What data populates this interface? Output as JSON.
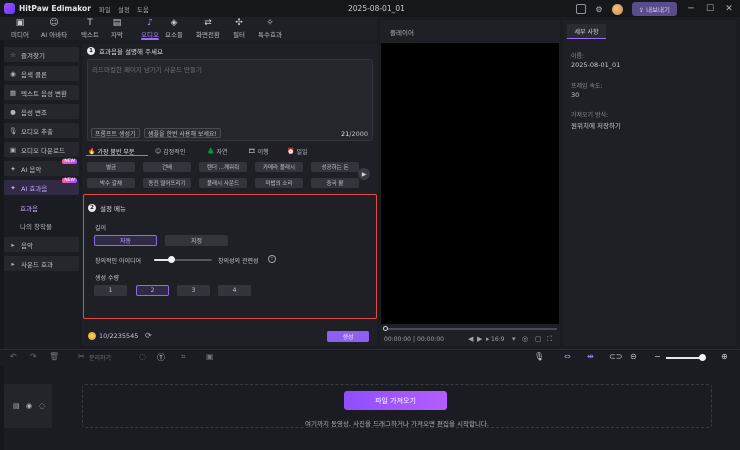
{
  "app": {
    "name": "HitPaw Edimakor",
    "menu": [
      "파일",
      "설정",
      "도움"
    ],
    "project_title": "2025-08-01_01",
    "export_label": "내보내기",
    "window_controls": {
      "minimize": "─",
      "maximize": "☐",
      "close": "✕"
    }
  },
  "toolbar": {
    "active": "오디오",
    "tools": [
      {
        "label": "미디어",
        "icon": "media-icon"
      },
      {
        "label": "AI 아바타",
        "icon": "avatar-icon"
      },
      {
        "label": "텍스트",
        "icon": "text-icon"
      },
      {
        "label": "자막",
        "icon": "subtitle-icon"
      },
      {
        "label": "오디오",
        "icon": "audio-icon"
      },
      {
        "label": "요소들",
        "icon": "elements-icon"
      },
      {
        "label": "화면전환",
        "icon": "transition-icon"
      },
      {
        "label": "필터",
        "icon": "filter-icon"
      },
      {
        "label": "특수효과",
        "icon": "effects-icon"
      }
    ]
  },
  "sidebar": {
    "items": [
      {
        "label": "즐겨찾기",
        "icon": "favorite-icon"
      },
      {
        "label": "음색 클론",
        "icon": "voice-clone-icon"
      },
      {
        "label": "텍스트 음성 변환",
        "icon": "tts-icon"
      },
      {
        "label": "음성 변조",
        "icon": "voice-changer-icon"
      },
      {
        "label": "오디오 추출",
        "icon": "mic-icon"
      },
      {
        "label": "오디오 다운로드",
        "icon": "download-icon"
      },
      {
        "label": "AI 음악",
        "icon": "ai-music-icon",
        "badge": "NEW"
      },
      {
        "label": "AI 효과음",
        "icon": "ai-sfx-icon",
        "badge": "NEW"
      }
    ],
    "subitems": [
      "효과음",
      "나의 창작물"
    ],
    "groups": [
      "음악",
      "사운드 효과"
    ]
  },
  "prompt": {
    "step": "1",
    "heading": "효과음을 설명해 주세요",
    "placeholder": "리드미컬한 페이지 넘기기 사운드 만들기",
    "chip_generate": "프롬프트 생성기",
    "chip_example": "샘플을 한번 사용해 보세요!",
    "count": "21",
    "max": "/2000"
  },
  "categories": {
    "tabs": [
      {
        "emoji": "🔥",
        "label": "가장 붐빈 부분"
      },
      {
        "emoji": "😊",
        "label": "감정적인"
      },
      {
        "emoji": "🌲",
        "label": "자연"
      },
      {
        "emoji": "🎞",
        "label": "이행"
      },
      {
        "emoji": "⏰",
        "label": "일일"
      }
    ],
    "tags_row1": [
      "별금",
      "건배",
      "렌더 ...깨워줘",
      "카메라 플래시",
      "성공하는 돈"
    ],
    "tags_row2": [
      "박수 갈채",
      "동전 떨어뜨리기",
      "플래시 사운드",
      "마법의 소리",
      "중국 활"
    ]
  },
  "settings": {
    "step": "2",
    "heading": "설정 메뉴",
    "length_label": "길이",
    "length_options": [
      "자동",
      "지정"
    ],
    "length_selected": "자동",
    "slider_left_label": "창의적인 아이디어",
    "slider_right_label": "창의성의 관련성",
    "slider_value_percent": 30,
    "count_label": "생성 수량",
    "count_options": [
      "1",
      "2",
      "3",
      "4"
    ],
    "count_selected": "2"
  },
  "generate": {
    "credits_used": "10",
    "credits_total": "/2235545",
    "button": "생성"
  },
  "player": {
    "title": "플레이어",
    "time_current": "00:00:00",
    "time_separator": "|",
    "time_total": "00:00:00",
    "ratio": "16:9"
  },
  "details": {
    "tab": "세부 사항",
    "name_label": "이름:",
    "name_value": "2025-08-01_01",
    "fps_label": "프레임 속도:",
    "fps_value": "30",
    "save_label": "가져오기 방식:",
    "save_value": "원위치에 저장하기"
  },
  "timeline": {
    "split_label": "분리하기",
    "import_button": "파일 가져오기",
    "drop_hint": "여기까지 동영상, 사진을 드래그하거나 가져오면 편집을 시작합니다."
  }
}
